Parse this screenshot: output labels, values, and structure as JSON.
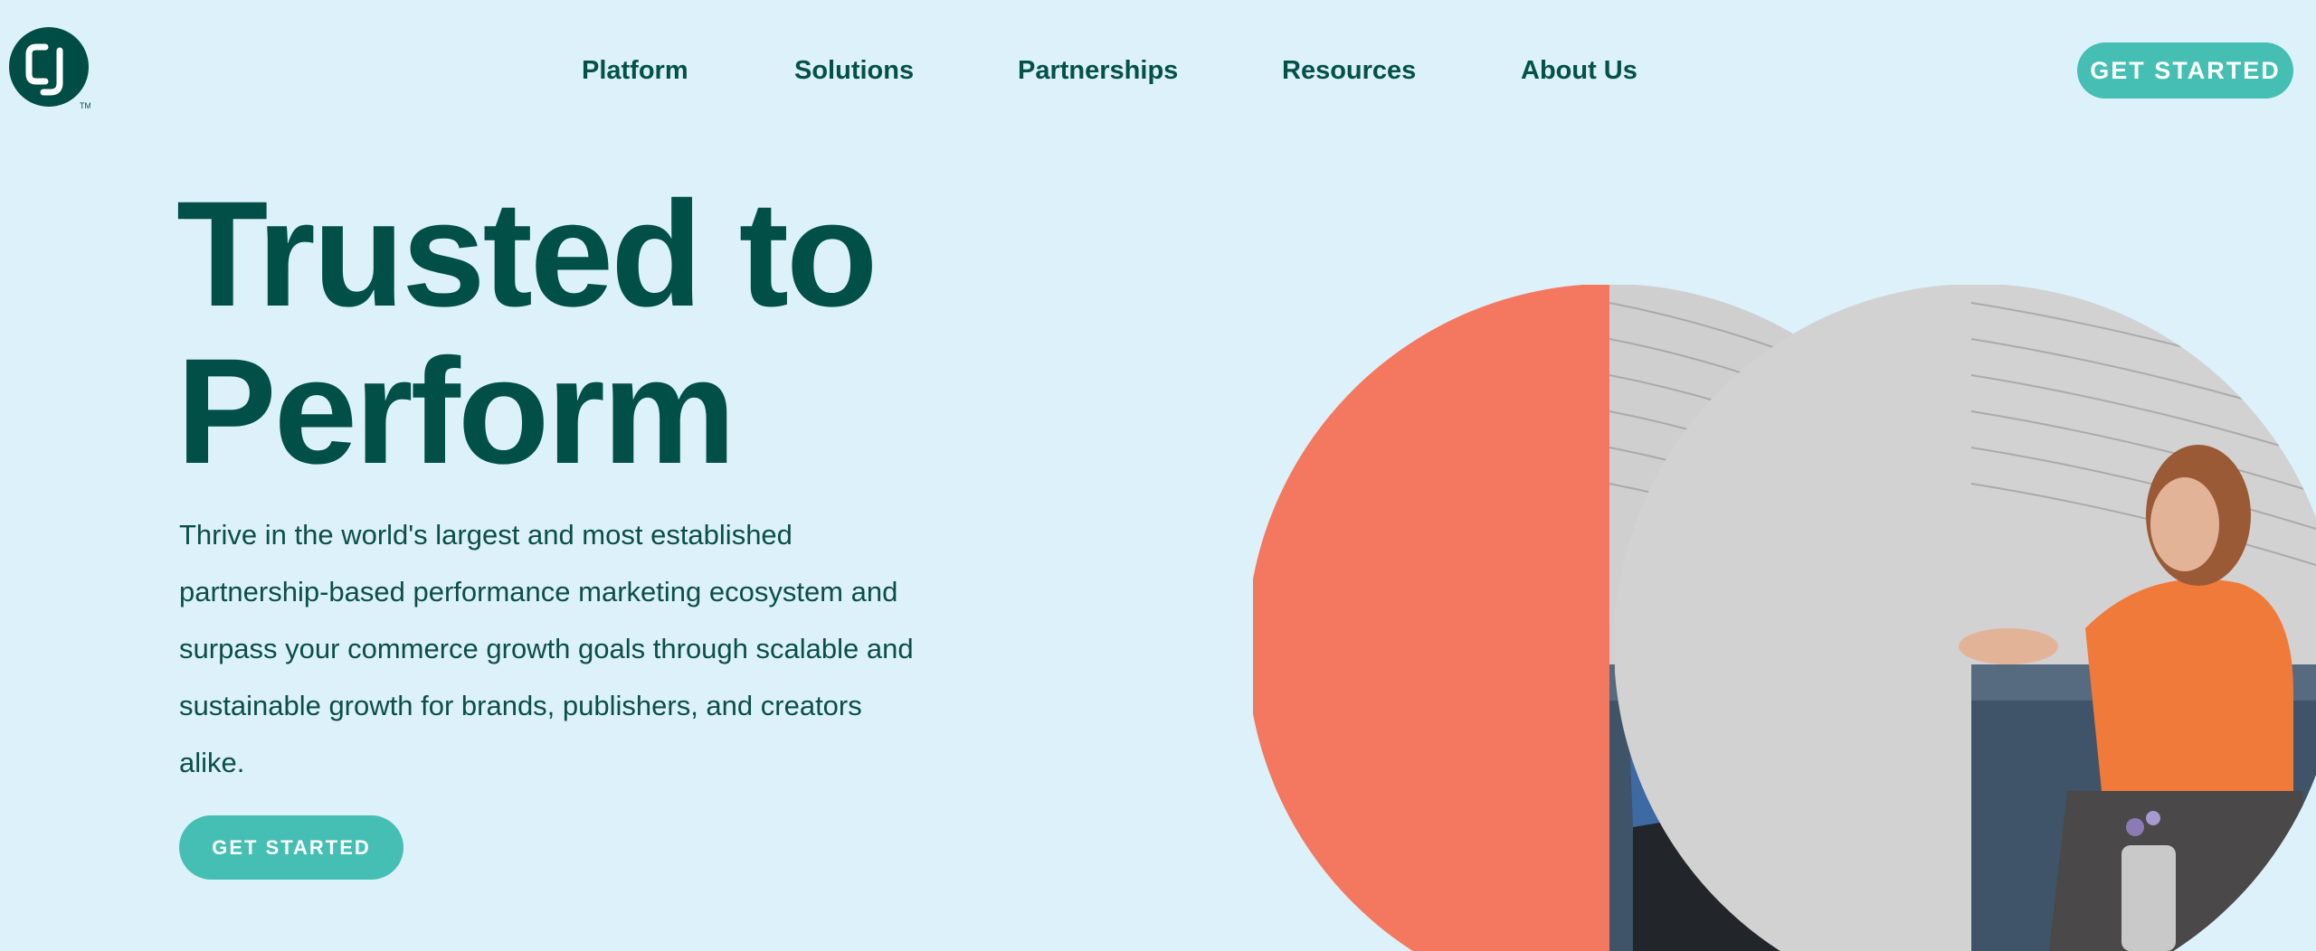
{
  "header": {
    "logo": {
      "text": "CJ",
      "trademark": "TM",
      "icon": "cj-logo-icon"
    },
    "nav": [
      "Platform",
      "Solutions",
      "Partnerships",
      "Resources",
      "About Us"
    ],
    "cta_label": "GET STARTED"
  },
  "hero": {
    "title_line1": "Trusted to",
    "title_line2": "Perform",
    "body": "Thrive in the world's largest and most established partnership-based performance marketing ecosystem and surpass your commerce growth goals through scalable and sustainable growth for brands, publishers, and creators alike.",
    "cta_label": "GET STARTED",
    "image": "two-people-talking-on-couch"
  },
  "colors": {
    "background": "#dcf1f9",
    "brand_dark": "#005048",
    "accent": "#45bfb3",
    "coral": "#f4775f"
  }
}
